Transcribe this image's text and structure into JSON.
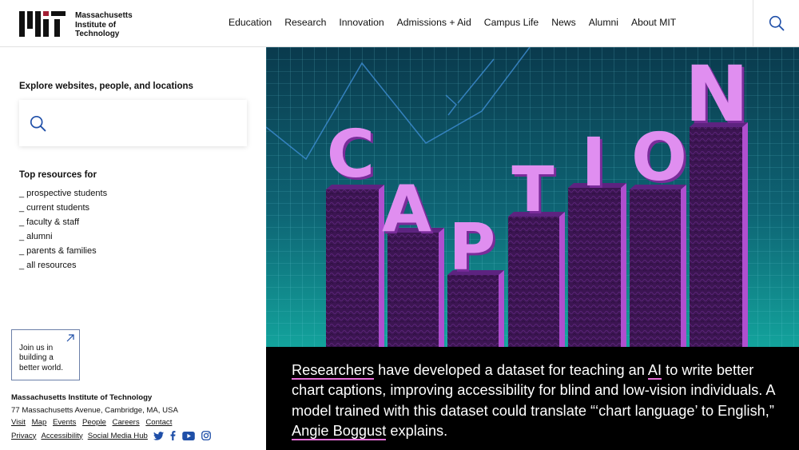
{
  "header": {
    "logo_lines": [
      "Massachusetts",
      "Institute of",
      "Technology"
    ],
    "nav": [
      "Education",
      "Research",
      "Innovation",
      "Admissions + Aid",
      "Campus Life",
      "News",
      "Alumni",
      "About MIT"
    ]
  },
  "sidebar": {
    "explore_title": "Explore websites, people, and locations",
    "search_placeholder": "",
    "resources_title": "Top resources for",
    "resources": [
      "_ prospective students",
      "_ current students",
      "_ faculty & staff",
      "_ alumni",
      "_ parents & families",
      "_ all resources"
    ],
    "join_lines": [
      "Join us in",
      "building a",
      "better world."
    ]
  },
  "footer": {
    "org": "Massachusetts Institute of Technology",
    "address": "77 Massachusetts Avenue, Cambridge, MA, USA",
    "links": [
      "Visit",
      "Map",
      "Events",
      "People",
      "Careers",
      "Contact"
    ],
    "links2": [
      "Privacy",
      "Accessibility",
      "Social Media Hub"
    ],
    "social_icons": [
      "twitter-icon",
      "facebook-icon",
      "youtube-icon",
      "instagram-icon"
    ]
  },
  "hero": {
    "letters": [
      "C",
      "A",
      "P",
      "T",
      "I",
      "O",
      "N"
    ],
    "colors": {
      "background": "#0f6f77",
      "bar": "#3c1552",
      "letter": "#e08ef0"
    }
  },
  "caption": {
    "link1": "Researchers",
    "text1": " have developed a dataset for teaching an ",
    "link2": "AI",
    "text2": " to write better chart captions, improving accessibility for blind and low-vision individuals. A model trained with this dataset could translate “‘chart language’ to English,” ",
    "link3": "Angie Boggust",
    "text3": " explains."
  }
}
